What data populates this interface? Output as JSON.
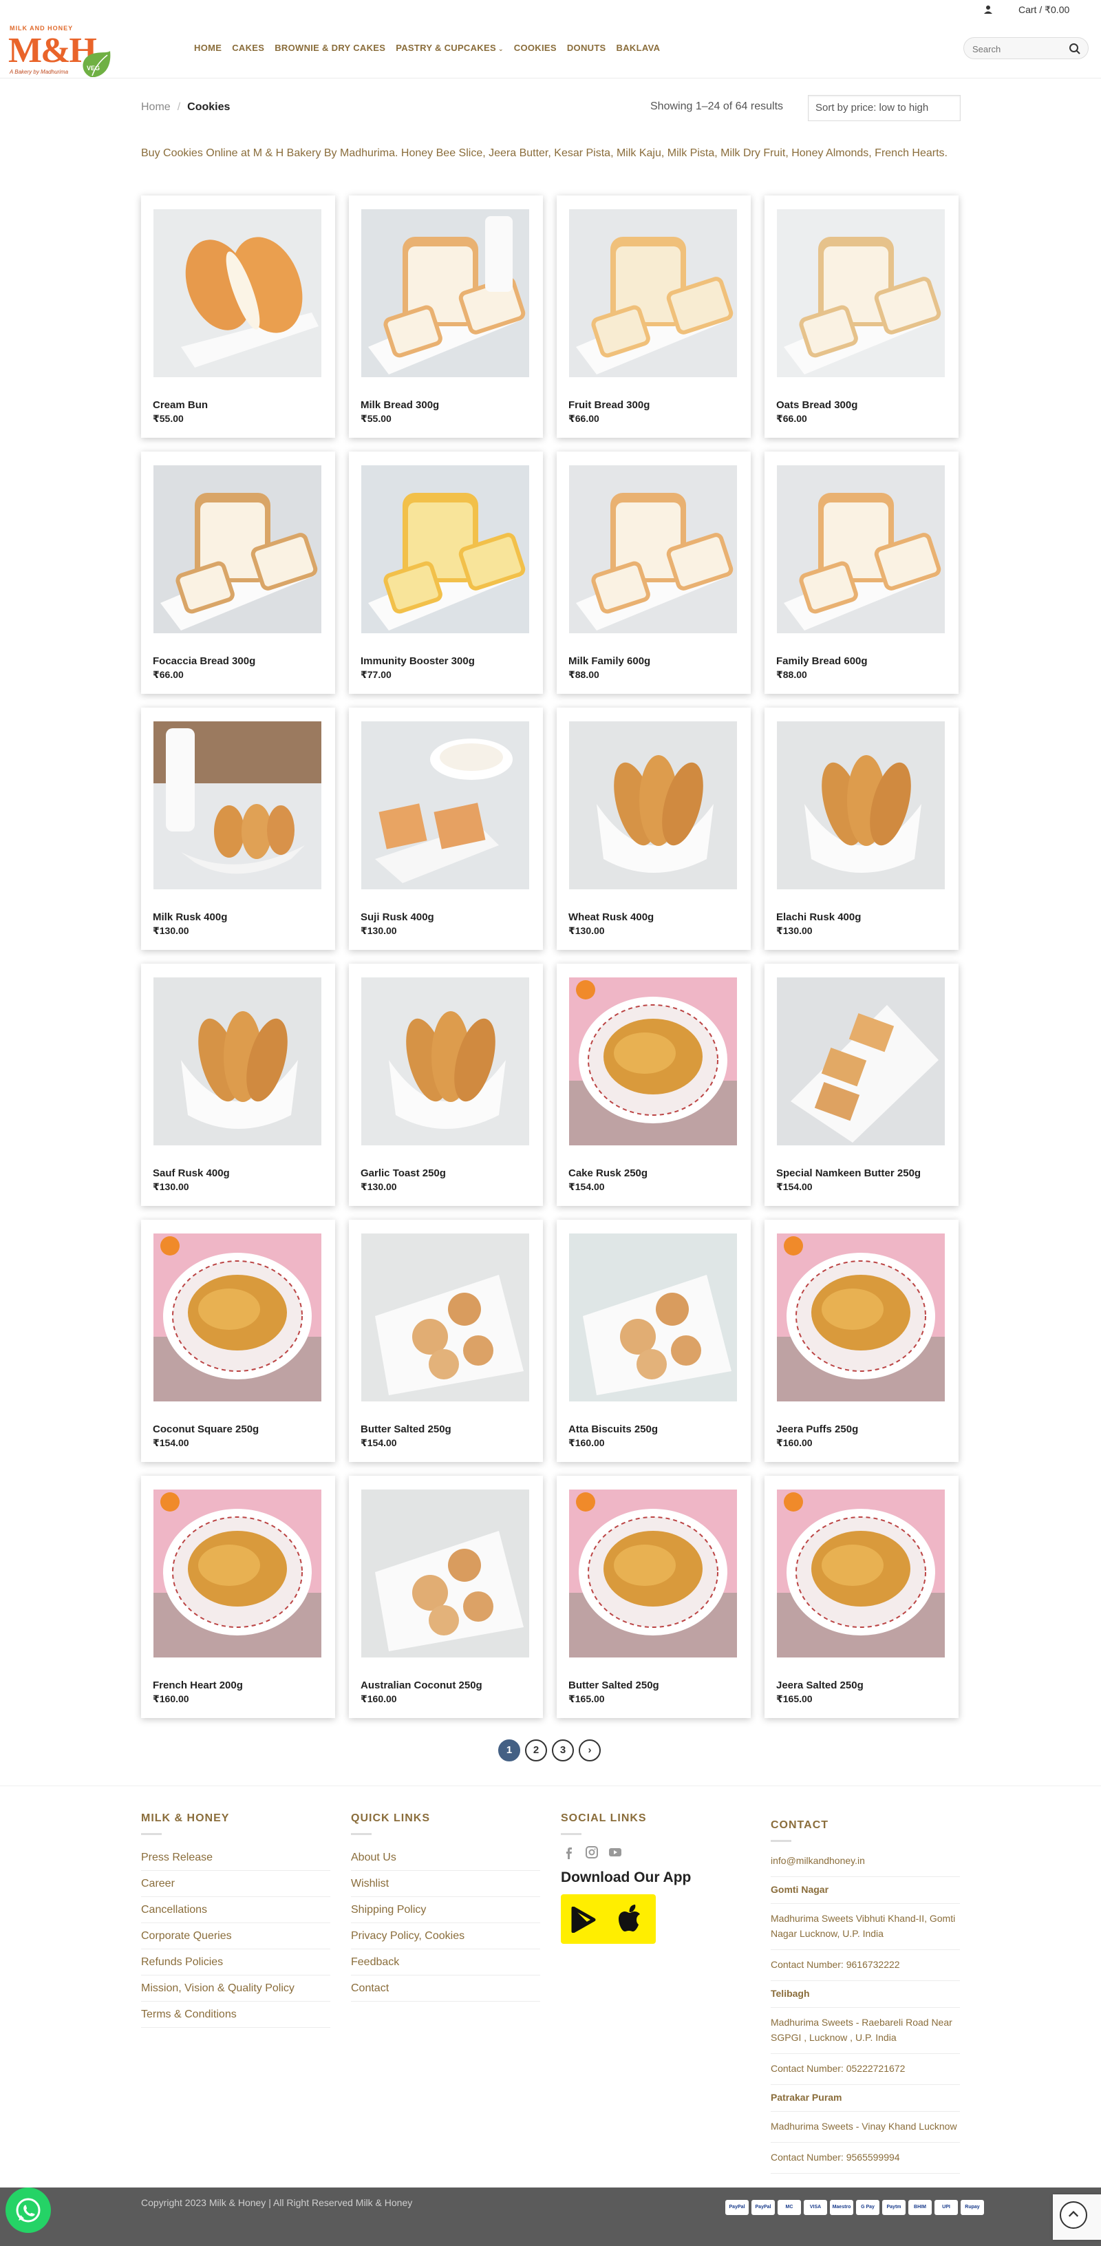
{
  "topbar": {
    "cart_label": "Cart / ₹0.00"
  },
  "logo": {
    "top_text": "MILK AND HONEY",
    "brand": "M&H",
    "tagline": "A Bakery by Madhurima",
    "veg_badge": "VEG"
  },
  "nav": [
    {
      "label": "HOME"
    },
    {
      "label": "CAKES"
    },
    {
      "label": "BROWNIE & DRY CAKES"
    },
    {
      "label": "PASTRY & CUPCAKES",
      "has_caret": true
    },
    {
      "label": "COOKIES"
    },
    {
      "label": "DONUTS"
    },
    {
      "label": "BAKLAVA"
    }
  ],
  "search": {
    "placeholder": "Search"
  },
  "breadcrumb": {
    "home": "Home",
    "separator": "/",
    "current": "Cookies"
  },
  "results": {
    "text": "Showing 1–24 of 64 results"
  },
  "sort": {
    "selected": "Sort by price: low to high"
  },
  "intro": "Buy Cookies Online at M & H Bakery By Madhurima. Honey Bee Slice, Jeera Butter, Kesar Pista, Milk Kaju, Milk Pista, Milk Dry Fruit, Honey Almonds, French Hearts.",
  "products": [
    {
      "name": "Cream Bun",
      "price": "₹55.00",
      "visual": "bun"
    },
    {
      "name": "Milk Bread 300g",
      "price": "₹55.00",
      "visual": "milkbread"
    },
    {
      "name": "Fruit Bread 300g",
      "price": "₹66.00",
      "visual": "fruitbread"
    },
    {
      "name": "Oats Bread 300g",
      "price": "₹66.00",
      "visual": "oatsbread"
    },
    {
      "name": "Focaccia Bread 300g",
      "price": "₹66.00",
      "visual": "focaccia"
    },
    {
      "name": "Immunity Booster 300g",
      "price": "₹77.00",
      "visual": "immunity"
    },
    {
      "name": "Milk Family 600g",
      "price": "₹88.00",
      "visual": "loaf"
    },
    {
      "name": "Family Bread 600g",
      "price": "₹88.00",
      "visual": "loaf"
    },
    {
      "name": "Milk Rusk 400g",
      "price": "₹130.00",
      "visual": "milkrusk"
    },
    {
      "name": "Suji Rusk 400g",
      "price": "₹130.00",
      "visual": "sujirusk"
    },
    {
      "name": "Wheat Rusk 400g",
      "price": "₹130.00",
      "visual": "rusk"
    },
    {
      "name": "Elachi Rusk 400g",
      "price": "₹130.00",
      "visual": "rusk"
    },
    {
      "name": "Sauf Rusk 400g",
      "price": "₹130.00",
      "visual": "rusk"
    },
    {
      "name": "Garlic Toast 250g",
      "price": "₹130.00",
      "visual": "garlic"
    },
    {
      "name": "Cake Rusk 250g",
      "price": "₹154.00",
      "visual": "pinkplate"
    },
    {
      "name": "Special Namkeen Butter 250g",
      "price": "₹154.00",
      "visual": "namkeen"
    },
    {
      "name": "Coconut Square 250g",
      "price": "₹154.00",
      "visual": "pinkplate"
    },
    {
      "name": "Butter Salted 250g",
      "price": "₹154.00",
      "visual": "cookies"
    },
    {
      "name": "Atta Biscuits 250g",
      "price": "₹160.00",
      "visual": "atta"
    },
    {
      "name": "Jeera Puffs 250g",
      "price": "₹160.00",
      "visual": "pinkplate"
    },
    {
      "name": "French Heart 200g",
      "price": "₹160.00",
      "visual": "pinkplate"
    },
    {
      "name": "Australian Coconut 250g",
      "price": "₹160.00",
      "visual": "australian"
    },
    {
      "name": "Butter Salted 250g",
      "price": "₹165.00",
      "visual": "pinkplate"
    },
    {
      "name": "Jeera Salted 250g",
      "price": "₹165.00",
      "visual": "pinkplate"
    }
  ],
  "pagination": {
    "pages": [
      "1",
      "2",
      "3"
    ],
    "active": "1",
    "next": "›"
  },
  "footer": {
    "col1": {
      "title": "MILK & HONEY",
      "links": [
        "Press Release",
        "Career",
        "Cancellations",
        "Corporate Queries",
        "Refunds Policies",
        "Mission, Vision & Quality Policy",
        "Terms & Conditions"
      ]
    },
    "col2": {
      "title": "QUICK LINKS",
      "links": [
        "About Us",
        "Wishlist",
        "Shipping Policy",
        "Privacy Policy, Cookies",
        "Feedback",
        "Contact"
      ]
    },
    "col3": {
      "title": "SOCIAL LINKS",
      "app_title": "Download Our App"
    },
    "col4": {
      "title": "CONTACT",
      "email": "info@milkandhoney.in",
      "locations": [
        {
          "name": "Gomti Nagar",
          "address": "Madhurima Sweets Vibhuti Khand-II, Gomti Nagar Lucknow, U.P. India",
          "phone": "Contact Number: 9616732222"
        },
        {
          "name": "Telibagh",
          "address": "Madhurima Sweets - Raebareli Road Near SGPGI , Lucknow , U.P. India",
          "phone": "Contact Number: 05222721672"
        },
        {
          "name": "Patrakar Puram",
          "address": "Madhurima Sweets - Vinay Khand Lucknow",
          "phone": "Contact Number: 9565599994"
        }
      ]
    }
  },
  "bottombar": {
    "copyright": "Copyright 2023 Milk & Honey | All Right Reserved Milk & Honey",
    "payments": [
      "PayPal",
      "PayPal",
      "MC",
      "VISA",
      "Maestro",
      "G Pay",
      "Paytm",
      "BHIM",
      "UPI",
      "Rupay"
    ]
  },
  "colors": {
    "accent": "#8a6d3b",
    "brand_orange": "#e9642a",
    "active_page": "#446084",
    "footer_bar": "#5b5b5b",
    "whatsapp": "#25d366",
    "app_badge": "#ffee00"
  }
}
